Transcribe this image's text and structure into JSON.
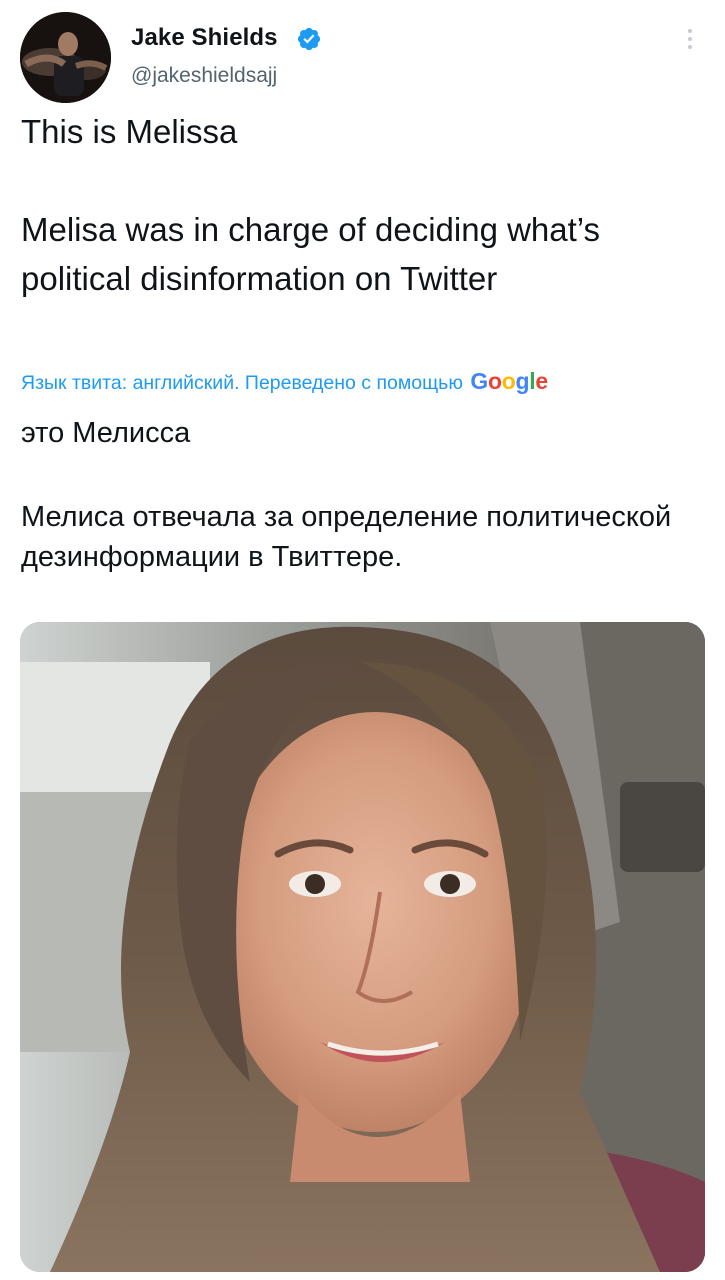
{
  "author": {
    "display_name": "Jake Shields",
    "handle": "@jakeshieldsajj",
    "verified": true
  },
  "tweet": {
    "intro": "This is Melissa",
    "main": "Melisa was in charge of deciding what’s political disinformation on Twitter"
  },
  "translation": {
    "note": "Язык твита: английский. Переведено с помощью",
    "provider": "Google",
    "intro": "это Мелисса",
    "main": "Мелиса отвечала за определение политической дезинформации в Твиттере."
  },
  "icons": {
    "verified": "verified-badge-icon",
    "more": "more-options-icon"
  },
  "colors": {
    "accent": "#1d9bf0",
    "secondary_text": "#536471",
    "primary_text": "#0f1419",
    "google_blue": "#4285F4",
    "google_red": "#EA4335",
    "google_yellow": "#FBBC05",
    "google_green": "#34A853"
  }
}
